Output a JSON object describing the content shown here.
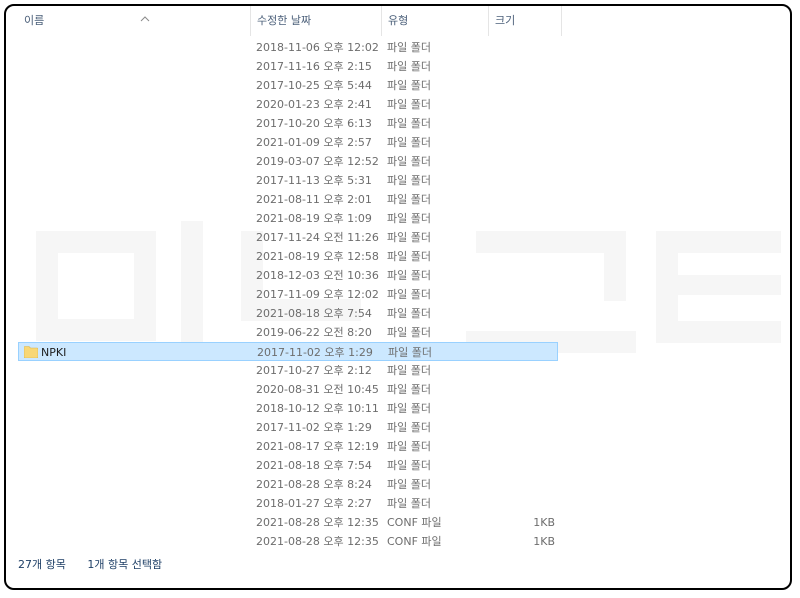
{
  "columns": {
    "name": "이름",
    "date": "수정한 날짜",
    "type": "유형",
    "size": "크기"
  },
  "files": [
    {
      "name": "",
      "date": "2018-11-06 오후 12:02",
      "type": "파일 폴더",
      "size": ""
    },
    {
      "name": "",
      "date": "2017-11-16 오후 2:15",
      "type": "파일 폴더",
      "size": ""
    },
    {
      "name": "",
      "date": "2017-10-25 오후 5:44",
      "type": "파일 폴더",
      "size": ""
    },
    {
      "name": "",
      "date": "2020-01-23 오후 2:41",
      "type": "파일 폴더",
      "size": ""
    },
    {
      "name": "",
      "date": "2017-10-20 오후 6:13",
      "type": "파일 폴더",
      "size": ""
    },
    {
      "name": "",
      "date": "2021-01-09 오후 2:57",
      "type": "파일 폴더",
      "size": ""
    },
    {
      "name": "",
      "date": "2019-03-07 오후 12:52",
      "type": "파일 폴더",
      "size": ""
    },
    {
      "name": "",
      "date": "2017-11-13 오후 5:31",
      "type": "파일 폴더",
      "size": ""
    },
    {
      "name": "",
      "date": "2021-08-11 오후 2:01",
      "type": "파일 폴더",
      "size": ""
    },
    {
      "name": "",
      "date": "2021-08-19 오후 1:09",
      "type": "파일 폴더",
      "size": ""
    },
    {
      "name": "",
      "date": "2017-11-24 오전 11:26",
      "type": "파일 폴더",
      "size": ""
    },
    {
      "name": "",
      "date": "2021-08-19 오후 12:58",
      "type": "파일 폴더",
      "size": ""
    },
    {
      "name": "",
      "date": "2018-12-03 오전 10:36",
      "type": "파일 폴더",
      "size": ""
    },
    {
      "name": "",
      "date": "2017-11-09 오후 12:02",
      "type": "파일 폴더",
      "size": ""
    },
    {
      "name": "",
      "date": "2021-08-18 오후 7:54",
      "type": "파일 폴더",
      "size": ""
    },
    {
      "name": "",
      "date": "2019-06-22 오전 8:20",
      "type": "파일 폴더",
      "size": ""
    },
    {
      "name": "NPKI",
      "date": "2017-11-02 오후 1:29",
      "type": "파일 폴더",
      "size": "",
      "selected": true
    },
    {
      "name": "",
      "date": "2017-10-27 오후 2:12",
      "type": "파일 폴더",
      "size": ""
    },
    {
      "name": "",
      "date": "2020-08-31 오전 10:45",
      "type": "파일 폴더",
      "size": ""
    },
    {
      "name": "",
      "date": "2018-10-12 오후 10:11",
      "type": "파일 폴더",
      "size": ""
    },
    {
      "name": "",
      "date": "2017-11-02 오후 1:29",
      "type": "파일 폴더",
      "size": ""
    },
    {
      "name": "",
      "date": "2021-08-17 오후 12:19",
      "type": "파일 폴더",
      "size": ""
    },
    {
      "name": "",
      "date": "2021-08-18 오후 7:54",
      "type": "파일 폴더",
      "size": ""
    },
    {
      "name": "",
      "date": "2021-08-28 오후 8:24",
      "type": "파일 폴더",
      "size": ""
    },
    {
      "name": "",
      "date": "2018-01-27 오후 2:27",
      "type": "파일 폴더",
      "size": ""
    },
    {
      "name": "",
      "date": "2021-08-28 오후 12:35",
      "type": "CONF 파일",
      "size": "1KB"
    },
    {
      "name": "",
      "date": "2021-08-28 오후 12:35",
      "type": "CONF 파일",
      "size": "1KB"
    }
  ],
  "status": {
    "item_count": "27개 항목",
    "selection": "1개 항목 선택함"
  },
  "icons": {
    "sort": "sort-ascending-icon",
    "folder": "folder-icon"
  },
  "colors": {
    "selection_bg": "#cce8ff",
    "selection_border": "#99d1ff",
    "header_text": "#4c607a",
    "folder_yellow": "#f8d775"
  }
}
